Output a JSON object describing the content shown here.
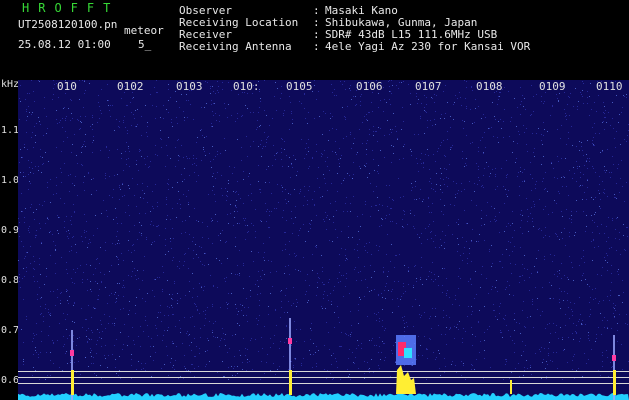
{
  "header": {
    "brand": "HROFFT",
    "filename": "UT2508120100.pn",
    "mode": "meteor",
    "datetime": "25.08.12 01:00",
    "interval": "5_",
    "meta": [
      {
        "key": "Observer",
        "value": "Masaki Kano"
      },
      {
        "key": "Receiving Location",
        "value": "Shibukawa, Gunma, Japan"
      },
      {
        "key": "Receiver",
        "value": "SDR# 43dB L15 111.6MHz USB"
      },
      {
        "key": "Receiving Antenna",
        "value": "4ele Yagi Az 230 for Kansai VOR"
      }
    ]
  },
  "spectrogram": {
    "y_unit": "kHz",
    "y_ticks": [
      "1.1",
      "1.0",
      "0.9",
      "0.8",
      "0.7",
      "0.6"
    ],
    "x_ticks": [
      "010",
      "0102",
      "0103",
      "010:",
      "0105",
      "0106",
      "0107",
      "0108",
      "0109",
      "0110"
    ],
    "background_color": "#0d0a5a",
    "reference_line_color": "#d8d8d8",
    "echo_color": "#ffee33",
    "baseline_color": "#22d0ff"
  }
}
